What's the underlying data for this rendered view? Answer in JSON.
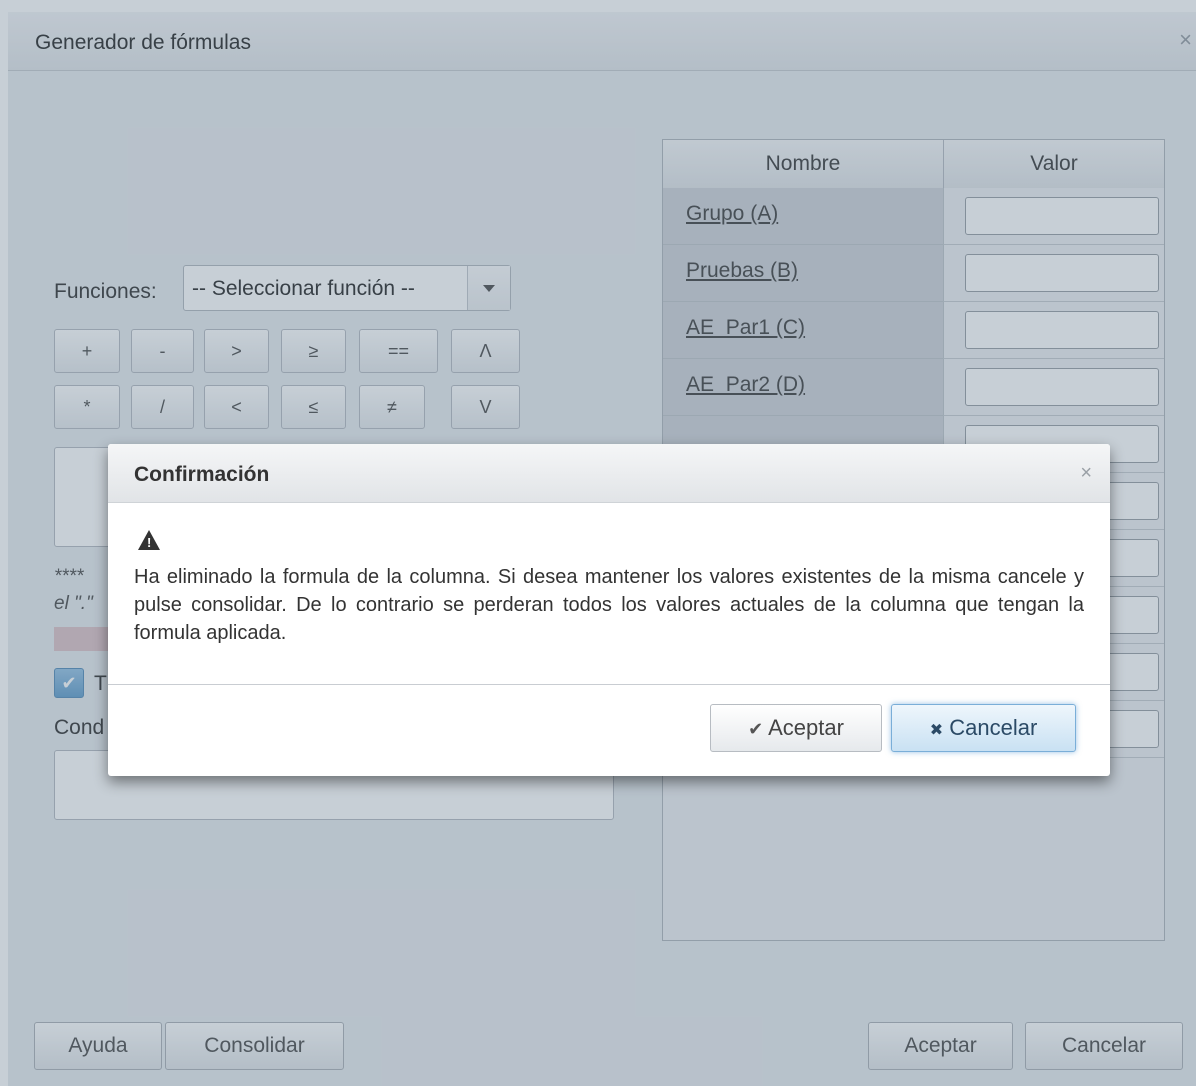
{
  "window": {
    "title": "Generador de fórmulas",
    "close_icon": "×"
  },
  "funciones": {
    "label": "Funciones:",
    "select_value": "-- Seleccionar función --"
  },
  "operators": {
    "row1": [
      "+",
      "-",
      ">",
      "≥",
      "==",
      "Λ"
    ],
    "row2": [
      "*",
      "/",
      "<",
      "≤",
      "≠",
      "V"
    ]
  },
  "left": {
    "note_line1": "**** ",
    "note_line2": "el \".\"",
    "checkbox_label": "T",
    "condition_label": "Cond"
  },
  "table": {
    "col_name": "Nombre",
    "col_value": "Valor",
    "rows": [
      "Grupo (A)",
      "Pruebas (B)",
      "AE_Par1 (C)",
      "AE_Par2 (D)"
    ]
  },
  "footer": {
    "ayuda": "Ayuda",
    "consolidar": "Consolidar",
    "aceptar": "Aceptar",
    "cancelar": "Cancelar"
  },
  "dialog": {
    "title": "Confirmación",
    "close_icon": "×",
    "message": "Ha eliminado la formula de la columna. Si desea mantener los valores existentes de la misma cancele y pulse consolidar. De lo contrario se perderan todos los valores actuales de la columna que tengan la formula aplicada.",
    "ok_icon": "✔",
    "ok_label": "Aceptar",
    "cancel_icon": "✖",
    "cancel_label": "Cancelar"
  }
}
